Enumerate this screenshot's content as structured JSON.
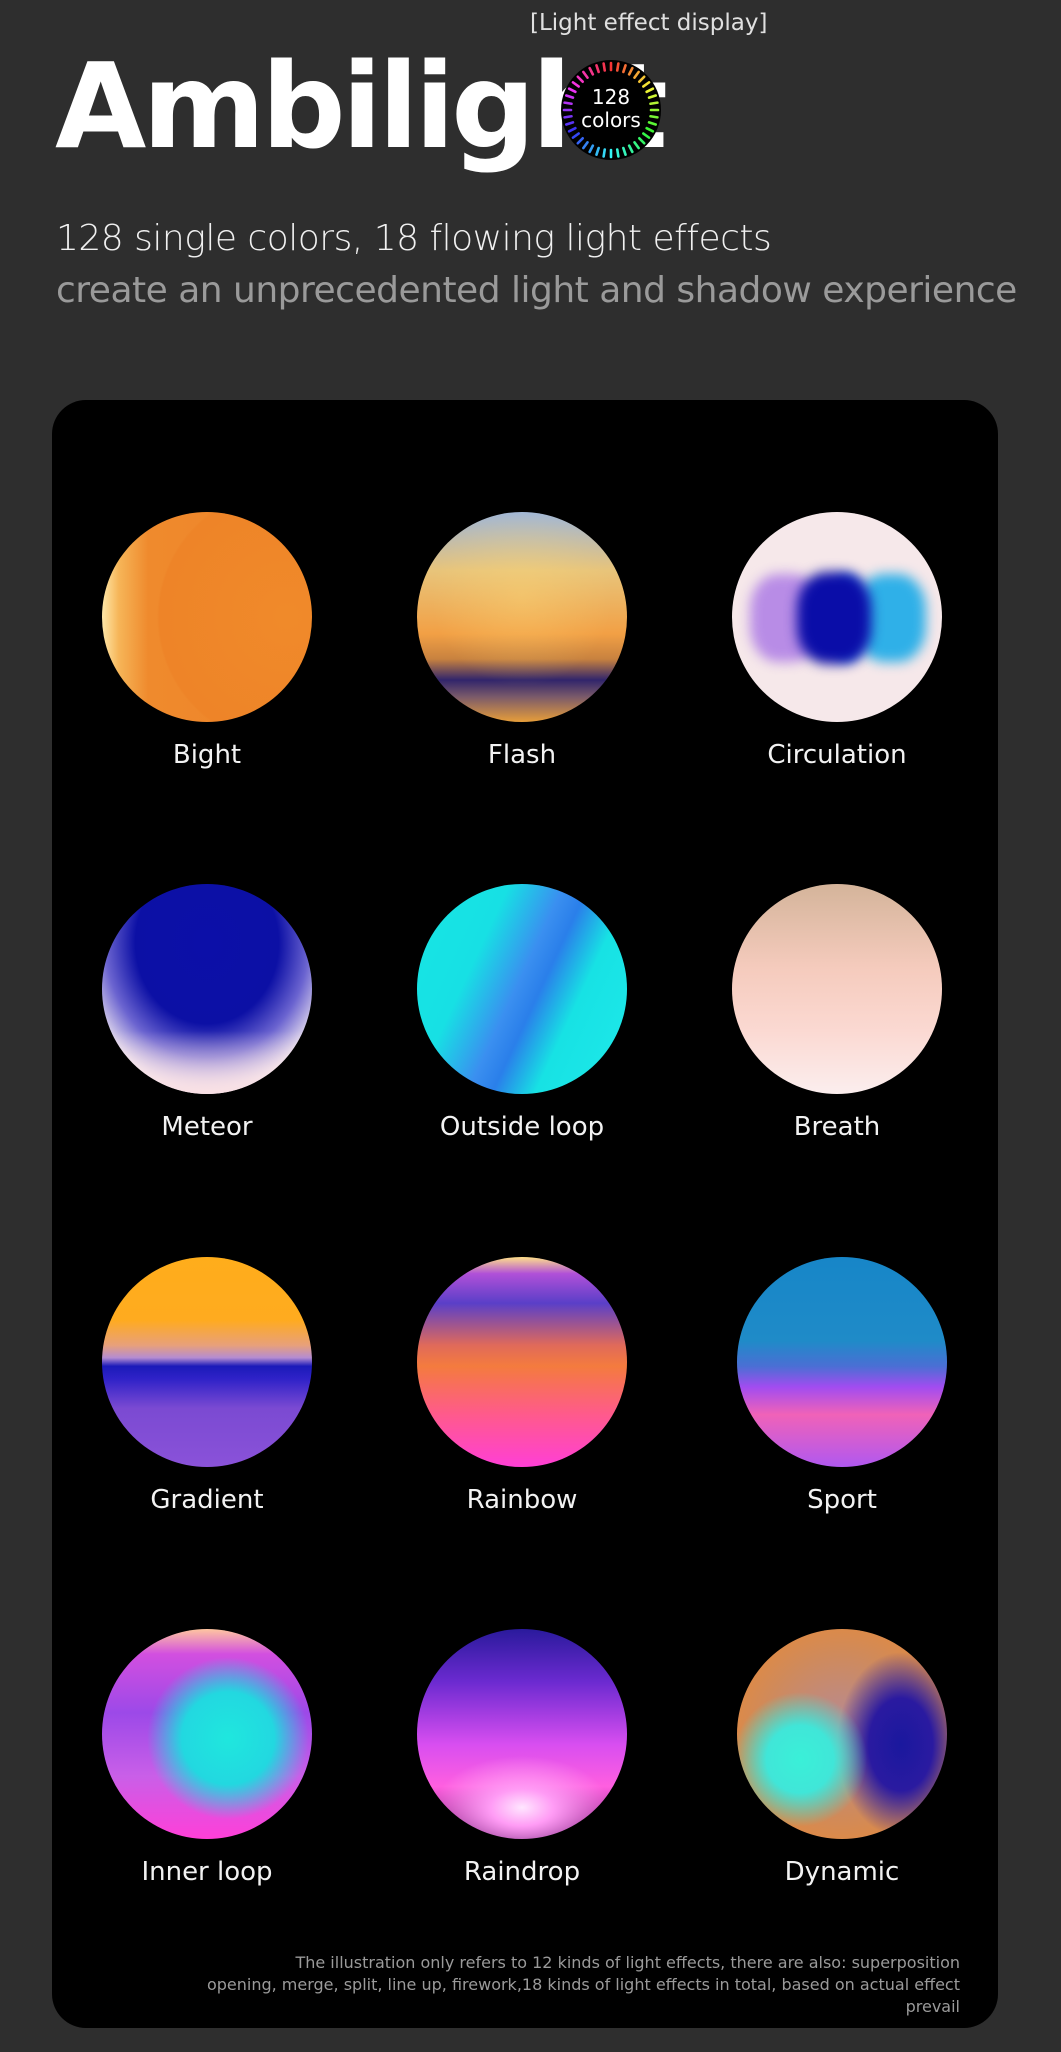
{
  "header": {
    "tag": "[Light effect display]",
    "title": "Ambilight",
    "badge": {
      "number": "128",
      "unit": "colors"
    },
    "subtitle_line1": "128 single colors, 18 flowing light effects",
    "subtitle_line2": "create an unprecedented light and shadow experience"
  },
  "effects": [
    {
      "label": "Bight"
    },
    {
      "label": "Flash"
    },
    {
      "label": "Circulation"
    },
    {
      "label": "Meteor"
    },
    {
      "label": "Outside loop"
    },
    {
      "label": "Breath"
    },
    {
      "label": "Gradient"
    },
    {
      "label": "Rainbow"
    },
    {
      "label": "Sport"
    },
    {
      "label": "Inner loop"
    },
    {
      "label": "Raindrop"
    },
    {
      "label": "Dynamic"
    }
  ],
  "footnote": {
    "line1": "The illustration only refers to 12 kinds of light effects, there are also: superposition",
    "line2": "opening, merge, split, line up, firework,18 kinds of light effects in total, based on actual effect prevail"
  },
  "colors": {
    "background": "#2e2e2e",
    "panel": "#000000",
    "text_primary": "#ffffff",
    "text_secondary": "#9a9a9a"
  }
}
